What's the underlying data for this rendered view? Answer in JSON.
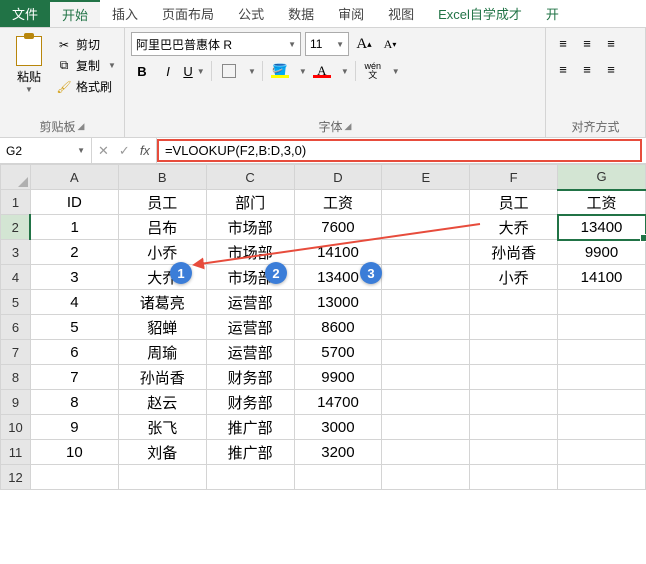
{
  "tabs": {
    "file": "文件",
    "home": "开始",
    "insert": "插入",
    "layout": "页面布局",
    "formulas": "公式",
    "data": "数据",
    "review": "审阅",
    "view": "视图",
    "extra": "Excel自学成才",
    "extra2": "开"
  },
  "ribbon": {
    "clipboard": {
      "paste": "粘贴",
      "cut": "剪切",
      "copy": "复制",
      "format": "格式刷",
      "label": "剪贴板"
    },
    "font": {
      "name": "阿里巴巴普惠体 R",
      "size": "11",
      "label": "字体",
      "wen": "wén"
    },
    "align": {
      "label": "对齐方式"
    }
  },
  "namebox": "G2",
  "formula": "=VLOOKUP(F2,B:D,3,0)",
  "columns": [
    "A",
    "B",
    "C",
    "D",
    "E",
    "F",
    "G"
  ],
  "rows": [
    "1",
    "2",
    "3",
    "4",
    "5",
    "6",
    "7",
    "8",
    "9",
    "10",
    "11",
    "12"
  ],
  "grid": {
    "r1": {
      "A": "ID",
      "B": "员工",
      "C": "部门",
      "D": "工资",
      "E": "",
      "F": "员工",
      "G": "工资"
    },
    "r2": {
      "A": "1",
      "B": "吕布",
      "C": "市场部",
      "D": "7600",
      "E": "",
      "F": "大乔",
      "G": "13400"
    },
    "r3": {
      "A": "2",
      "B": "小乔",
      "C": "市场部",
      "D": "14100",
      "E": "",
      "F": "孙尚香",
      "G": "9900"
    },
    "r4": {
      "A": "3",
      "B": "大乔",
      "C": "市场部",
      "D": "13400",
      "E": "",
      "F": "小乔",
      "G": "14100"
    },
    "r5": {
      "A": "4",
      "B": "诸葛亮",
      "C": "运营部",
      "D": "13000",
      "E": "",
      "F": "",
      "G": ""
    },
    "r6": {
      "A": "5",
      "B": "貂蝉",
      "C": "运营部",
      "D": "8600",
      "E": "",
      "F": "",
      "G": ""
    },
    "r7": {
      "A": "6",
      "B": "周瑜",
      "C": "运营部",
      "D": "5700",
      "E": "",
      "F": "",
      "G": ""
    },
    "r8": {
      "A": "7",
      "B": "孙尚香",
      "C": "财务部",
      "D": "9900",
      "E": "",
      "F": "",
      "G": ""
    },
    "r9": {
      "A": "8",
      "B": "赵云",
      "C": "财务部",
      "D": "14700",
      "E": "",
      "F": "",
      "G": ""
    },
    "r10": {
      "A": "9",
      "B": "张飞",
      "C": "推广部",
      "D": "3000",
      "E": "",
      "F": "",
      "G": ""
    },
    "r11": {
      "A": "10",
      "B": "刘备",
      "C": "推广部",
      "D": "3200",
      "E": "",
      "F": "",
      "G": ""
    }
  },
  "badges": {
    "b1": "1",
    "b2": "2",
    "b3": "3"
  }
}
